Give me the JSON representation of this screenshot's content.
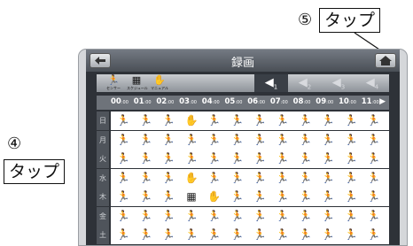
{
  "callouts": [
    {
      "number": "⑤",
      "text": "タップ"
    },
    {
      "number": "④",
      "text": "タップ"
    }
  ],
  "screen": {
    "title": "録画",
    "back_icon": "back-arrow-icon",
    "home_icon": "home-icon",
    "mode_icons": [
      {
        "icon": "motion-record-icon",
        "label": "センサー"
      },
      {
        "icon": "schedule-record-icon",
        "label": "スケジュール"
      },
      {
        "icon": "manual-record-icon",
        "label": "マニュアル"
      }
    ],
    "camera_segments": [
      "1",
      "2",
      "3",
      "4"
    ],
    "active_segment": "1",
    "hours": [
      "00",
      "01",
      "02",
      "03",
      "04",
      "05",
      "06",
      "07",
      "08",
      "09",
      "10",
      "11"
    ],
    "hours_suffix": ":00",
    "next_icon": "next-arrow-icon",
    "days": [
      "日",
      "月",
      "火",
      "水",
      "木",
      "金",
      "土"
    ],
    "grid": [
      [
        "s",
        "s",
        "s",
        "m",
        "s",
        "s",
        "s",
        "s",
        "s",
        "s",
        "s",
        "s"
      ],
      [
        "s",
        "s",
        "s",
        "s",
        "s",
        "s",
        "s",
        "s",
        "s",
        "s",
        "s",
        "s"
      ],
      [
        "s",
        "s",
        "s",
        "s",
        "s",
        "s",
        "s",
        "s",
        "s",
        "s",
        "s",
        "s"
      ],
      [
        "s",
        "s",
        "s",
        "m",
        "s",
        "s",
        "s",
        "s",
        "s",
        "s",
        "s",
        "s"
      ],
      [
        "s",
        "s",
        "s",
        "c",
        "m",
        "s",
        "s",
        "s",
        "s",
        "s",
        "s",
        "s"
      ],
      [
        "s",
        "s",
        "s",
        "s",
        "s",
        "s",
        "s",
        "s",
        "s",
        "s",
        "s",
        "s"
      ],
      [
        "s",
        "s",
        "s",
        "s",
        "s",
        "s",
        "s",
        "s",
        "s",
        "s",
        "s",
        "s"
      ]
    ],
    "accent": "#4a4f56"
  }
}
